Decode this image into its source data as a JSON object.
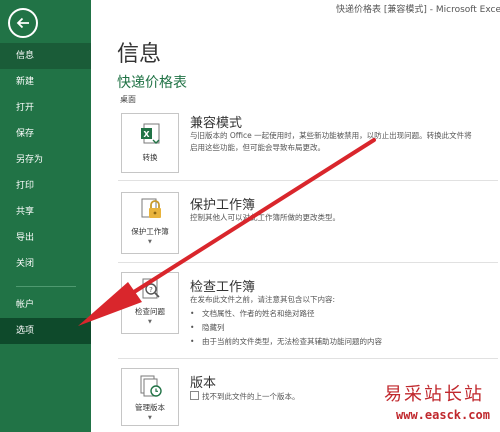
{
  "window": {
    "title": "快递价格表  [兼容模式] - Microsoft Excel"
  },
  "sidebar": {
    "items": [
      {
        "label": "信息"
      },
      {
        "label": "新建"
      },
      {
        "label": "打开"
      },
      {
        "label": "保存"
      },
      {
        "label": "另存为"
      },
      {
        "label": "打印"
      },
      {
        "label": "共享"
      },
      {
        "label": "导出"
      },
      {
        "label": "关闭"
      },
      {
        "label": "帐户"
      },
      {
        "label": "选项"
      }
    ],
    "active_item": "信息",
    "highlighted_item": "选项"
  },
  "main": {
    "page_title": "信息",
    "document_name": "快递价格表",
    "document_location": "桌面",
    "sections": [
      {
        "button_label": "转换",
        "heading": "兼容模式",
        "description_lines": [
          "与旧版本的 Office 一起使用时，某些新功能被禁用，以防止出现问题。转换此文件将",
          "启用这些功能，但可能会导致布局更改。"
        ],
        "icon": "excel-convert-icon"
      },
      {
        "button_label": "保护工作簿",
        "heading": "保护工作簿",
        "description_lines": [
          "控制其他人可以对此工作簿所做的更改类型。"
        ],
        "icon": "lock-icon"
      },
      {
        "button_label": "检查问题",
        "heading": "检查工作簿",
        "description_lines": [
          "在发布此文件之前，请注意其包含以下内容:"
        ],
        "bullets": [
          "文档属性、作者的姓名和绝对路径",
          "隐藏列",
          "由于当前的文件类型，无法检查其辅助功能问题的内容"
        ],
        "icon": "inspect-icon"
      },
      {
        "button_label": "管理版本",
        "heading": "版本",
        "description_lines": [
          "找不到此文件的上一个版本。"
        ],
        "icon": "versions-icon"
      }
    ]
  },
  "watermark": {
    "text": "易采站长站",
    "url": "www.easck.com"
  },
  "colors": {
    "sidebar": "#217346",
    "accent": "#217346",
    "arrow": "#d9262c"
  }
}
